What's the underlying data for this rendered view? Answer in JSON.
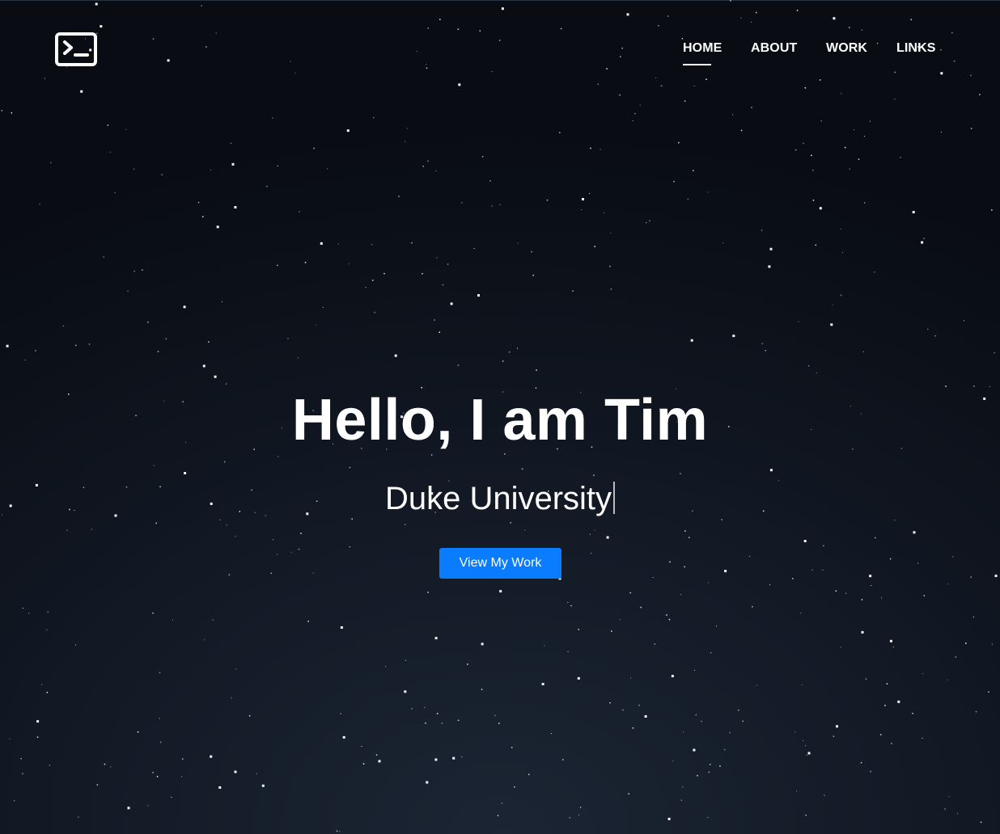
{
  "nav": {
    "items": [
      {
        "label": "HOME",
        "active": true
      },
      {
        "label": "ABOUT",
        "active": false
      },
      {
        "label": "WORK",
        "active": false
      },
      {
        "label": "LINKS",
        "active": false
      }
    ]
  },
  "logo": {
    "icon": "terminal-icon"
  },
  "hero": {
    "title": "Hello, I am Tim",
    "subtitle": "Duke University",
    "button_label": "View My Work"
  },
  "colors": {
    "background": "#0d121b",
    "accent": "#0a7cff",
    "text": "#ffffff"
  }
}
